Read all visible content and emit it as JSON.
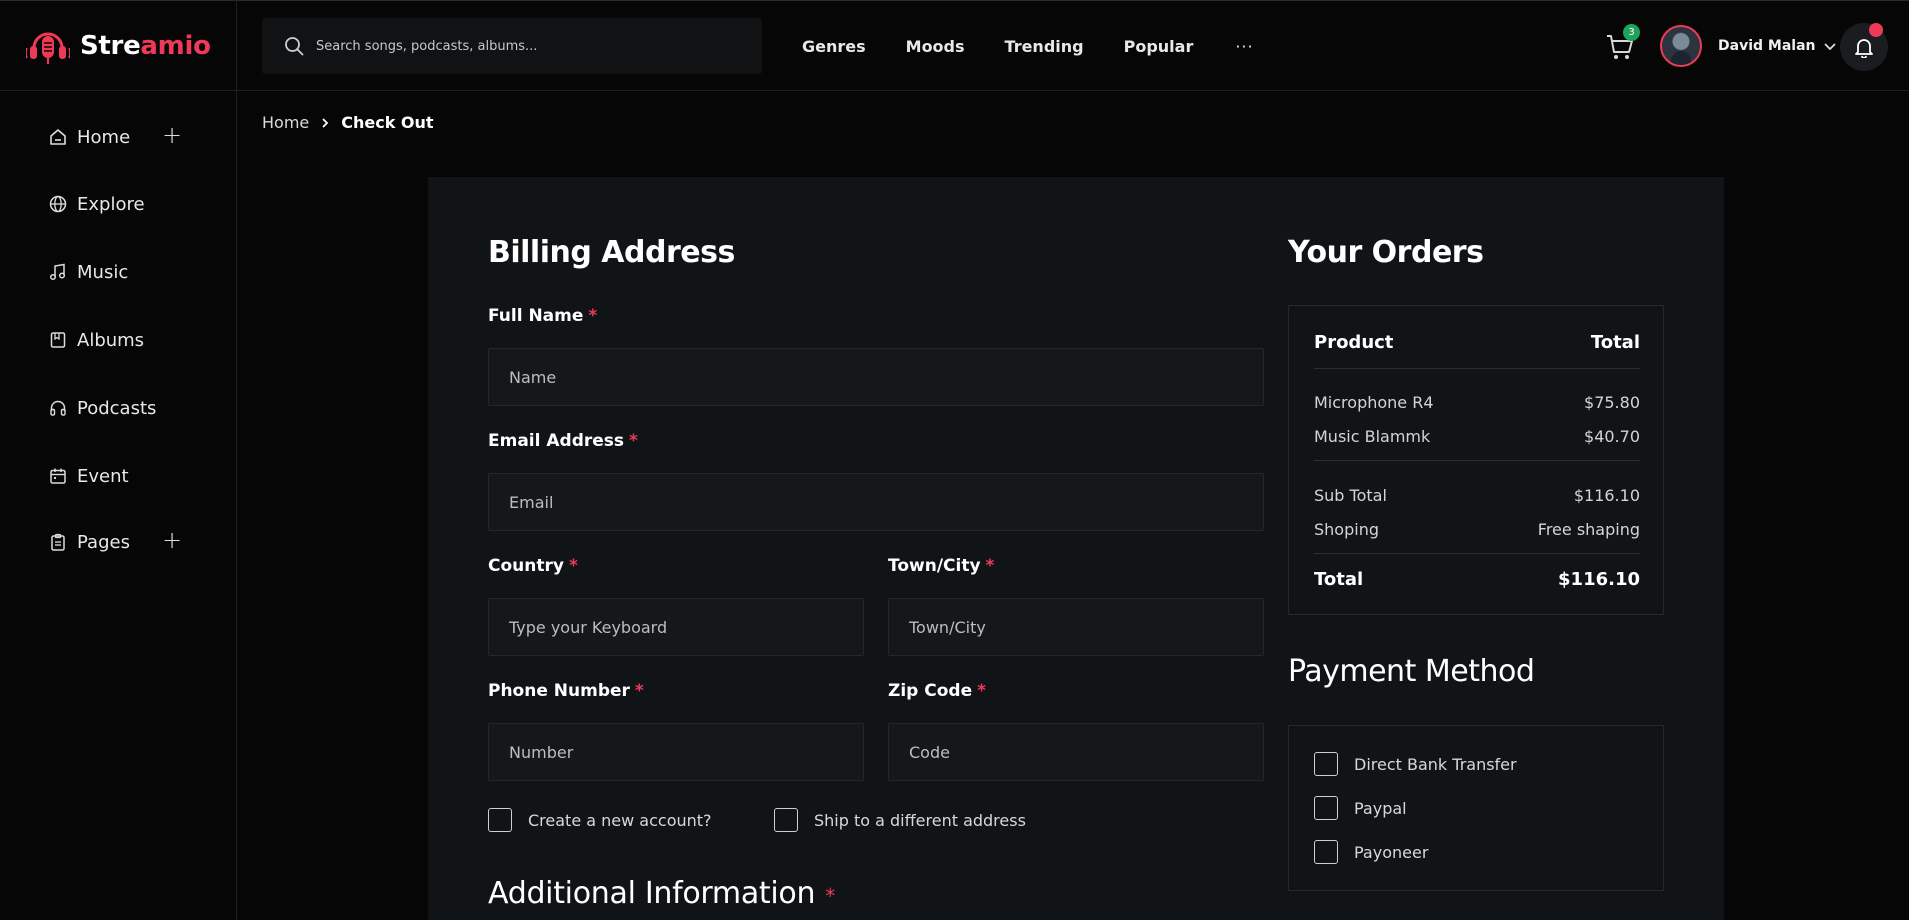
{
  "brand": {
    "name_part1": "Stre",
    "name_part2": "amio"
  },
  "search": {
    "placeholder": "Search songs, podcasts, albums..."
  },
  "nav": {
    "items": [
      "Genres",
      "Moods",
      "Trending",
      "Popular"
    ],
    "more": "···"
  },
  "cart": {
    "count": "3"
  },
  "user": {
    "name": "David Malan"
  },
  "sidebar": {
    "items": [
      {
        "label": "Home",
        "icon": "home-icon"
      },
      {
        "label": "Explore",
        "icon": "globe-icon"
      },
      {
        "label": "Music",
        "icon": "music-note-icon"
      },
      {
        "label": "Albums",
        "icon": "album-icon"
      },
      {
        "label": "Podcasts",
        "icon": "headphones-icon"
      },
      {
        "label": "Event",
        "icon": "calendar-icon"
      },
      {
        "label": "Pages",
        "icon": "clipboard-icon"
      }
    ]
  },
  "breadcrumb": {
    "home": "Home",
    "current": "Check Out"
  },
  "billing": {
    "title": "Billing Address",
    "full_name_label": "Full Name",
    "full_name_placeholder": "Name",
    "email_label": "Email Address",
    "email_placeholder": "Email",
    "country_label": "Country",
    "country_placeholder": "Type your Keyboard",
    "town_label": "Town/City",
    "town_placeholder": "Town/City",
    "phone_label": "Phone Number",
    "phone_placeholder": "Number",
    "zip_label": "Zip Code",
    "zip_placeholder": "Code",
    "required_mark": "*",
    "create_account": "Create a new account?",
    "ship_different": "Ship to a different address",
    "additional_title": "Additional Information"
  },
  "orders": {
    "title": "Your Orders",
    "product_header": "Product",
    "total_header": "Total",
    "items": [
      {
        "name": "Microphone R4",
        "price": "$75.80"
      },
      {
        "name": "Music Blammk",
        "price": "$40.70"
      }
    ],
    "subtotal_label": "Sub Total",
    "subtotal_value": "$116.10",
    "shipping_label": "Shoping",
    "shipping_value": "Free shaping",
    "total_label": "Total",
    "total_value": "$116.10"
  },
  "payment": {
    "title": "Payment Method",
    "methods": [
      "Direct Bank Transfer",
      "Paypal",
      "Payoneer"
    ]
  },
  "colors": {
    "accent": "#ee3a57",
    "badge": "#1fa35a",
    "background": "#060606",
    "card": "#111416"
  }
}
